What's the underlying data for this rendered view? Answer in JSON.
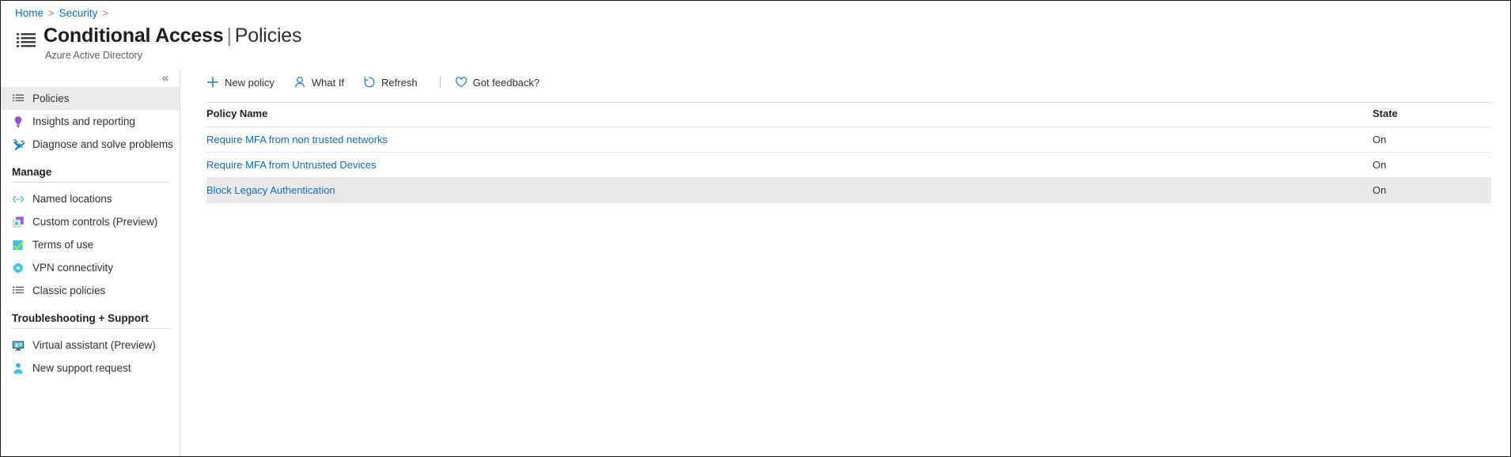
{
  "breadcrumb": {
    "items": [
      "Home",
      "Security"
    ],
    "separator": ">"
  },
  "header": {
    "icon": "policy-list-icon",
    "title_main": "Conditional Access",
    "title_divider": "|",
    "title_sub": "Policies",
    "subtitle": "Azure Active Directory"
  },
  "sidebar": {
    "collapse_label": "«",
    "top_items": [
      {
        "label": "Policies",
        "icon": "list-icon",
        "selected": true
      },
      {
        "label": "Insights and reporting",
        "icon": "lightbulb-icon",
        "selected": false
      },
      {
        "label": "Diagnose and solve problems",
        "icon": "wrench-screwdriver-icon",
        "selected": false
      }
    ],
    "groups": [
      {
        "header": "Manage",
        "items": [
          {
            "label": "Named locations",
            "icon": "code-brackets-icon"
          },
          {
            "label": "Custom controls (Preview)",
            "icon": "custom-control-icon"
          },
          {
            "label": "Terms of use",
            "icon": "checkbox-checked-icon"
          },
          {
            "label": "VPN connectivity",
            "icon": "gear-icon"
          },
          {
            "label": "Classic policies",
            "icon": "list-icon"
          }
        ]
      },
      {
        "header": "Troubleshooting + Support",
        "items": [
          {
            "label": "Virtual assistant (Preview)",
            "icon": "monitor-assistant-icon"
          },
          {
            "label": "New support request",
            "icon": "person-support-icon"
          }
        ]
      }
    ]
  },
  "toolbar": {
    "new_policy": "New policy",
    "what_if": "What If",
    "refresh": "Refresh",
    "got_feedback": "Got feedback?"
  },
  "table": {
    "columns": [
      "Policy Name",
      "State"
    ],
    "rows": [
      {
        "name": "Require MFA from non trusted networks",
        "state": "On"
      },
      {
        "name": "Require MFA from Untrusted Devices",
        "state": "On"
      },
      {
        "name": "Block Legacy Authentication",
        "state": "On"
      }
    ]
  },
  "colors": {
    "link": "#0f6cbd",
    "accent": "#0078d4",
    "selected_row": "#eceae8",
    "selected_nav": "#edebe9",
    "border": "#e1dfdd"
  }
}
